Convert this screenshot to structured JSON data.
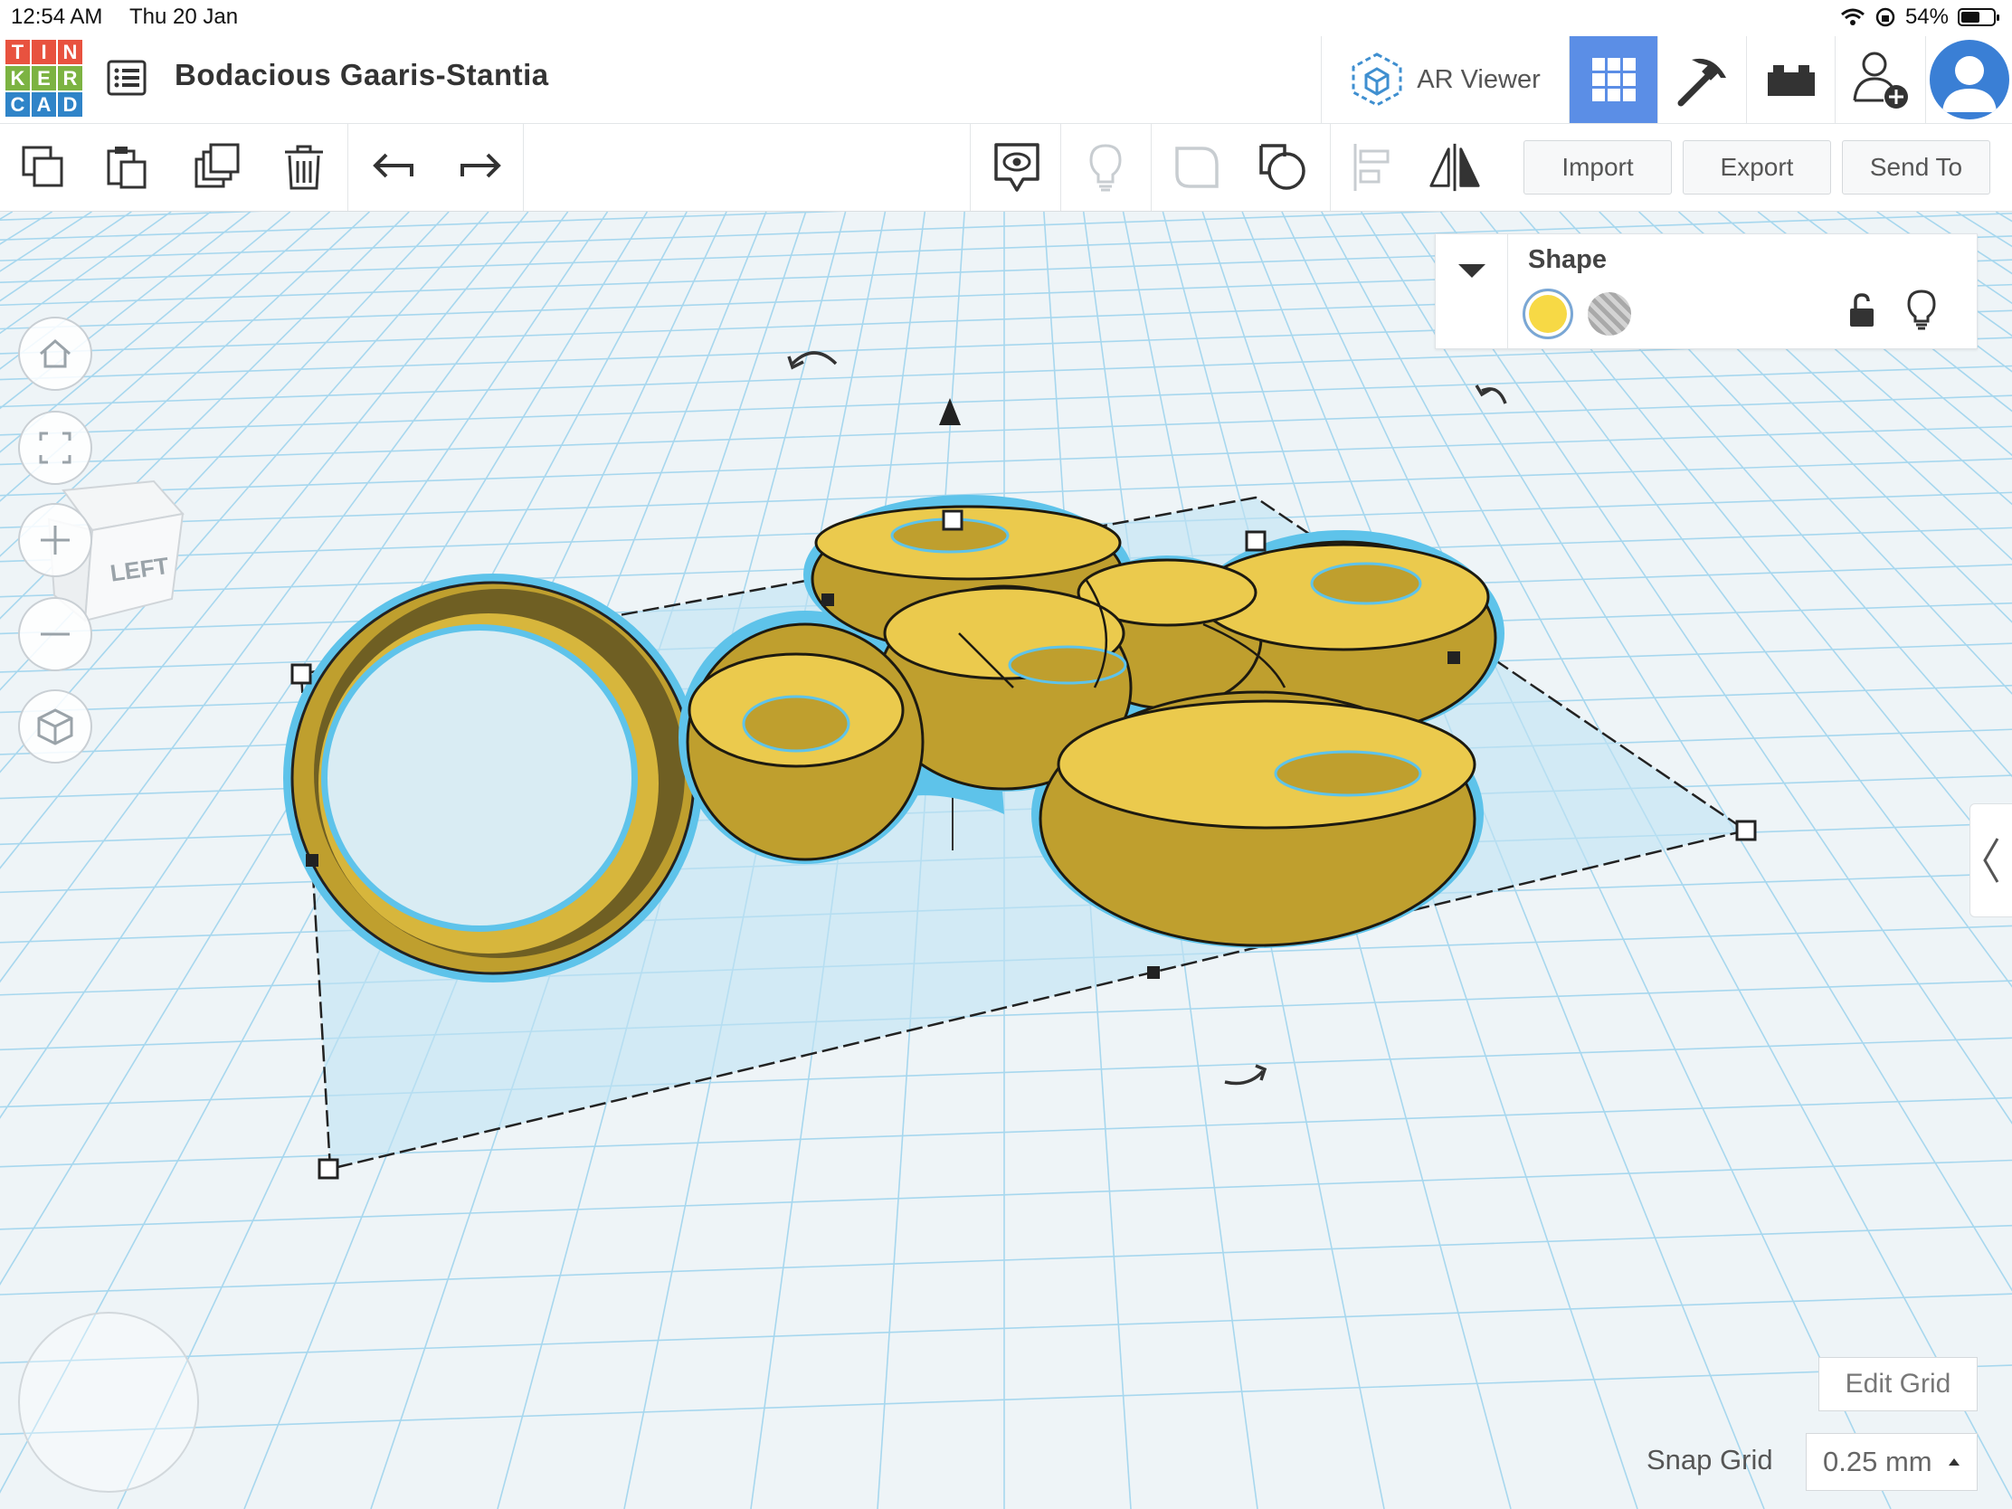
{
  "status_bar": {
    "time": "12:54 AM",
    "date": "Thu 20 Jan",
    "battery": "54%",
    "battery_level": 0.54
  },
  "logo": {
    "letters": [
      "T",
      "I",
      "N",
      "K",
      "E",
      "R",
      "C",
      "A",
      "D"
    ],
    "colors": [
      "#e8523f",
      "#e8523f",
      "#e8523f",
      "#7cb342",
      "#7cb342",
      "#7cb342",
      "#2f84c8",
      "#2f84c8",
      "#2f84c8"
    ]
  },
  "header": {
    "title": "Bodacious Gaaris-Stantia",
    "ar_viewer_label": "AR Viewer",
    "icons": [
      "list-icon",
      "ar-cube-icon",
      "grid-view-icon",
      "pickaxe-icon",
      "bricks-icon",
      "add-user-icon",
      "avatar"
    ]
  },
  "toolbar": {
    "import_label": "Import",
    "export_label": "Export",
    "send_to_label": "Send To",
    "icons": [
      "copy-icon",
      "paste-icon",
      "duplicate-icon",
      "delete-icon",
      "undo-icon",
      "redo-icon",
      "note-icon",
      "light-icon",
      "group-icon",
      "ungroup-icon",
      "align-icon",
      "mirror-icon"
    ]
  },
  "viewcube": {
    "face_label": "LEFT"
  },
  "inspector": {
    "title": "Shape",
    "solid_color": "#f7d945",
    "options": [
      "solid-swatch",
      "hole-swatch",
      "lock-icon",
      "visibility-bulb-icon"
    ]
  },
  "footer": {
    "edit_grid_label": "Edit Grid",
    "snap_grid_label": "Snap Grid",
    "snap_grid_value": "0.25 mm"
  },
  "colors": {
    "accent": "#5b8ee6",
    "shape_yellow": "#e8c84a",
    "selection": "#5ec3ea",
    "grid": "#9fd3ec"
  }
}
